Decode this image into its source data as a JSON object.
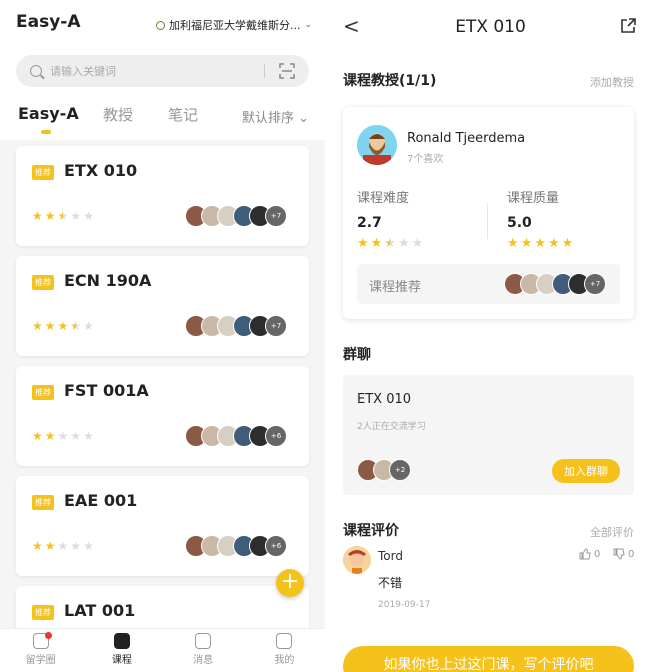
{
  "left": {
    "app_title": "Easy-A",
    "university": "加利福尼亚大学戴维斯分...",
    "search_placeholder": "请输入关键词",
    "tabs": [
      "Easy-A",
      "教授",
      "笔记"
    ],
    "sort_label": "默认排序",
    "courses": [
      {
        "badge": "推荐",
        "code": "ETX 010",
        "rating": 2.5,
        "more": "+7"
      },
      {
        "badge": "推荐",
        "code": "ECN 190A",
        "rating": 3.5,
        "more": "+7"
      },
      {
        "badge": "推荐",
        "code": "FST 001A",
        "rating": 2,
        "more": "+6"
      },
      {
        "badge": "推荐",
        "code": "EAE 001",
        "rating": 2,
        "more": "+6"
      },
      {
        "badge": "推荐",
        "code": "LAT 001",
        "rating": 0,
        "more": ""
      }
    ],
    "fab": "+",
    "nav": [
      {
        "label": "留学圈",
        "icon": "home-icon"
      },
      {
        "label": "课程",
        "icon": "book-icon"
      },
      {
        "label": "消息",
        "icon": "chat-icon"
      },
      {
        "label": "我的",
        "icon": "profile-icon"
      }
    ]
  },
  "right": {
    "title": "ETX 010",
    "professor_section": "课程教授(1/1)",
    "add_professor": "添加教授",
    "professor": {
      "name": "Ronald Tjeerdema",
      "likes": "7个喜欢",
      "difficulty_label": "课程难度",
      "difficulty_value": "2.7",
      "difficulty_rating": 2.5,
      "quality_label": "课程质量",
      "quality_value": "5.0",
      "quality_rating": 5,
      "recommend_label": "课程推荐",
      "recommend_more": "+7"
    },
    "group_section": "群聊",
    "group": {
      "name": "ETX 010",
      "subtitle": "2人正在交流学习",
      "more": "+2",
      "join": "加入群聊"
    },
    "review_section": "课程评价",
    "all_reviews": "全部评价",
    "review": {
      "user": "Tord",
      "text": "不错",
      "date": "2019-09-17",
      "likes": "0",
      "dislikes": "0"
    },
    "cta": "如果你也上过这门课，写个评价吧"
  },
  "colors": {
    "accent": "#f5c21b",
    "background": "#f5f5f5"
  }
}
